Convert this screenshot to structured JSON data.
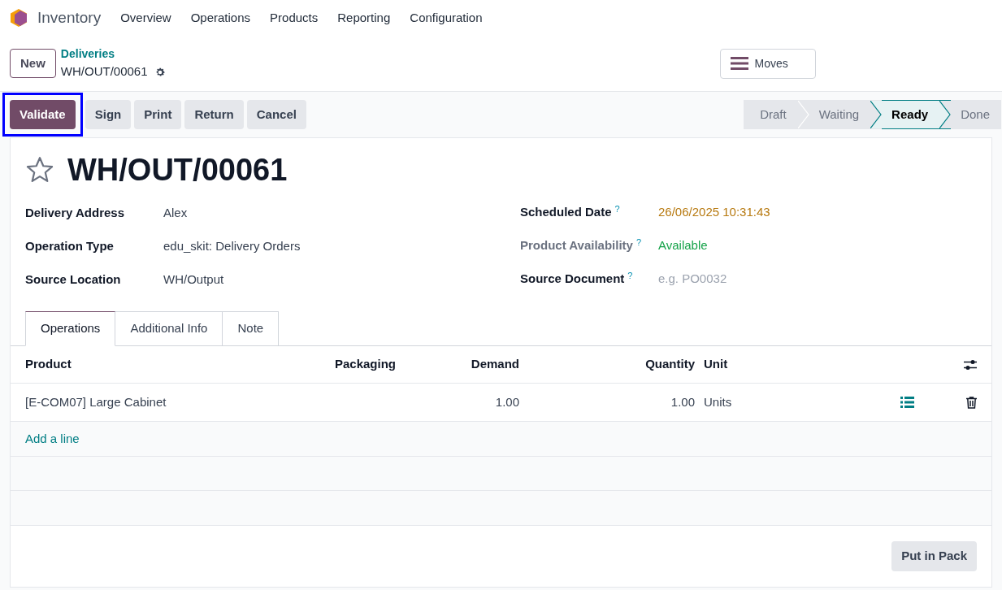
{
  "navbar": {
    "app": "Inventory",
    "menu": [
      "Overview",
      "Operations",
      "Products",
      "Reporting",
      "Configuration"
    ]
  },
  "control_panel": {
    "new_button": "New",
    "breadcrumb": "Deliveries",
    "record": "WH/OUT/00061",
    "moves_button": "Moves"
  },
  "actions": [
    {
      "label": "Validate",
      "kind": "primary",
      "highlighted": true
    },
    {
      "label": "Sign",
      "kind": "secondary",
      "highlighted": false
    },
    {
      "label": "Print",
      "kind": "secondary",
      "highlighted": false
    },
    {
      "label": "Return",
      "kind": "secondary",
      "highlighted": false
    },
    {
      "label": "Cancel",
      "kind": "secondary",
      "highlighted": false
    }
  ],
  "stages": [
    {
      "label": "Draft",
      "selected": false
    },
    {
      "label": "Waiting",
      "selected": false
    },
    {
      "label": "Ready",
      "selected": true
    },
    {
      "label": "Done",
      "selected": false
    }
  ],
  "title": "WH/OUT/00061",
  "left_fields": [
    {
      "label": "Delivery Address",
      "value": "Alex",
      "kind": "text",
      "help": false,
      "disabled": false
    },
    {
      "label": "Operation Type",
      "value": "edu_skit: Delivery Orders",
      "kind": "text",
      "help": false,
      "disabled": false
    },
    {
      "label": "Source Location",
      "value": "WH/Output",
      "kind": "text",
      "help": false,
      "disabled": false
    }
  ],
  "right_fields": [
    {
      "label": "Scheduled Date",
      "value": "26/06/2025 10:31:43",
      "kind": "date",
      "help": true,
      "disabled": false
    },
    {
      "label": "Product Availability",
      "value": "Available",
      "kind": "status",
      "help": true,
      "disabled": true
    },
    {
      "label": "Source Document",
      "placeholder": "e.g. PO0032",
      "kind": "input",
      "help": true,
      "disabled": false
    }
  ],
  "help_mark": "?",
  "tabs": [
    {
      "label": "Operations",
      "selected": true
    },
    {
      "label": "Additional Info",
      "selected": false
    },
    {
      "label": "Note",
      "selected": false
    }
  ],
  "table": {
    "columns": [
      "Product",
      "Packaging",
      "Demand",
      "Quantity",
      "Unit"
    ],
    "rows": [
      {
        "product": "[E-COM07] Large Cabinet",
        "packaging": "",
        "demand": "1.00",
        "quantity": "1.00",
        "unit": "Units"
      }
    ],
    "add_line": "Add a line"
  },
  "footer_button": "Put in Pack"
}
